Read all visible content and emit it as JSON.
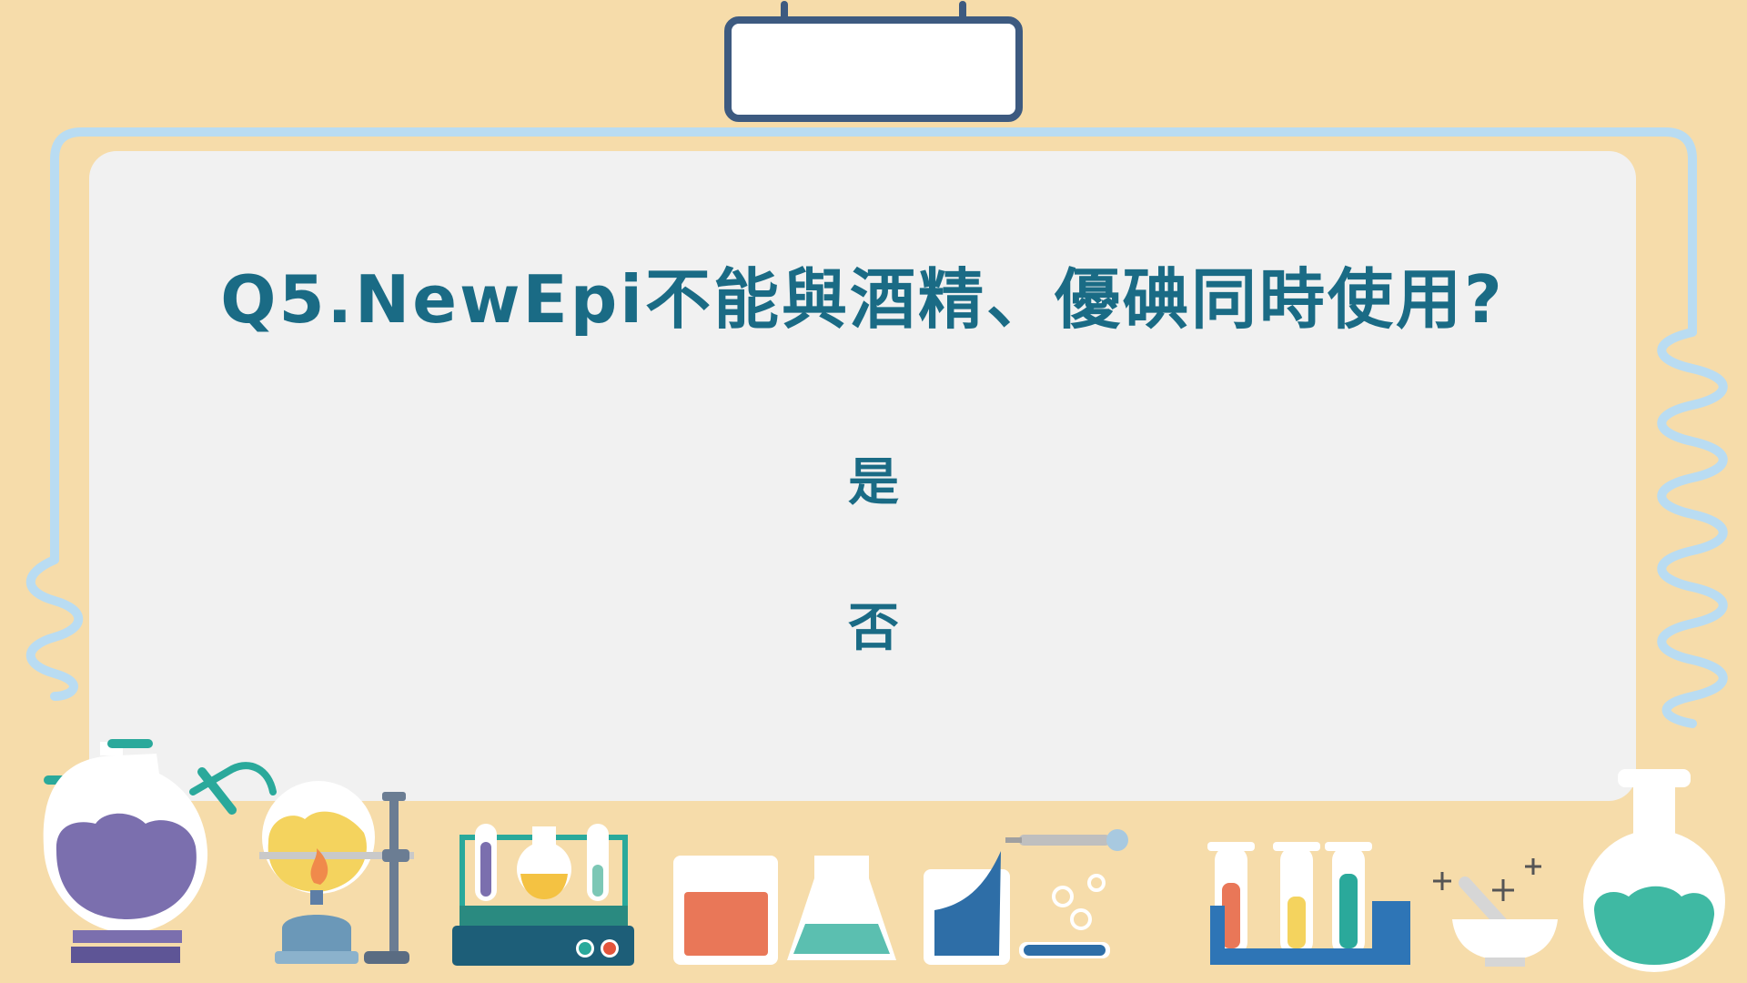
{
  "slide": {
    "question": "Q5.NewEpi不能與酒精、優碘同時使用?",
    "options": [
      {
        "label": "是"
      },
      {
        "label": "否"
      }
    ]
  },
  "colors": {
    "background": "#f6dcaa",
    "panel": "#f1f1f1",
    "text": "#1a6b85",
    "tube_blue": "#b9dcf2",
    "navy": "#3d5a80"
  },
  "decorations": [
    "round-bottom-flask-icon",
    "spirit-lamp-flask-icon",
    "retort-stand-icon",
    "test-tube-rack-icon",
    "beaker-icon",
    "erlenmeyer-flask-icon",
    "dropper-beaker-icon",
    "dropper-icon",
    "test-tube-set-icon",
    "mortar-pestle-icon",
    "volumetric-flask-icon"
  ]
}
